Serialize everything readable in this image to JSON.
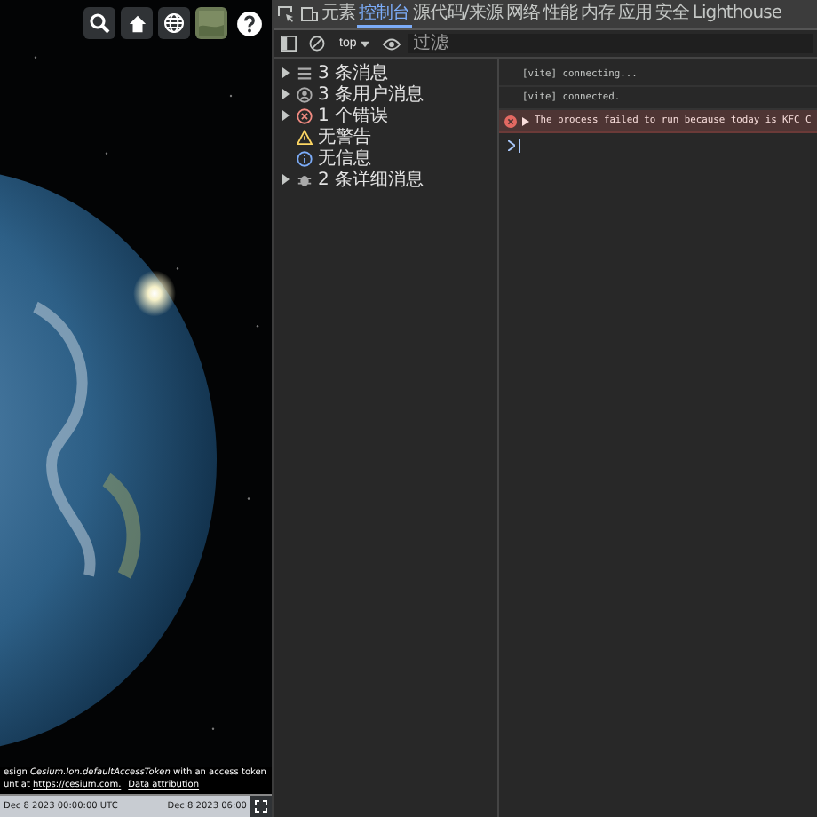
{
  "viewer": {
    "credits": {
      "token_notice": "esign *Cesium.Ion.defaultAccessToken* with an access token",
      "account_prefix": "unt at ",
      "account_link": "https://cesium.com.",
      "attribution_link": "Data attribution"
    },
    "timeline": {
      "start": "Dec 8 2023 00:00:00 UTC",
      "end": "Dec 8 2023 06:00"
    }
  },
  "devtools": {
    "tabs": [
      {
        "label": "元素",
        "selected": false
      },
      {
        "label": "控制台",
        "selected": true
      },
      {
        "label": "源代码/来源",
        "selected": false
      },
      {
        "label": "网络",
        "selected": false
      },
      {
        "label": "性能",
        "selected": false
      },
      {
        "label": "内存",
        "selected": false
      },
      {
        "label": "应用",
        "selected": false
      },
      {
        "label": "安全",
        "selected": false
      },
      {
        "label": "Lighthouse",
        "selected": false
      }
    ],
    "context": "top",
    "filter": {
      "placeholder": "过滤"
    },
    "sidebar": [
      {
        "label": "3 条消息",
        "kind": "messages",
        "expandable": true
      },
      {
        "label": "3 条用户消息",
        "kind": "user",
        "expandable": true
      },
      {
        "label": "1 个错误",
        "kind": "error",
        "expandable": true
      },
      {
        "label": "无警告",
        "kind": "warning",
        "expandable": false
      },
      {
        "label": "无信息",
        "kind": "info",
        "expandable": false
      },
      {
        "label": "2 条详细消息",
        "kind": "verbose",
        "expandable": true
      }
    ],
    "messages": [
      {
        "kind": "log",
        "text": "[vite] connecting..."
      },
      {
        "kind": "log",
        "text": "[vite] connected."
      },
      {
        "kind": "error",
        "text": "The process failed to run because today is KFC C"
      }
    ]
  }
}
